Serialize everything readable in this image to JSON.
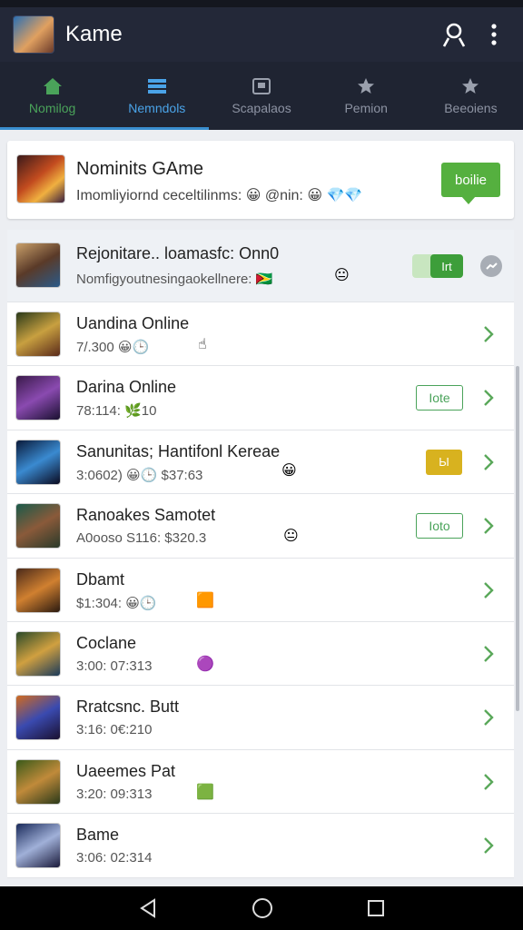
{
  "app": {
    "title": "Kame"
  },
  "tabs": [
    {
      "label": "Nomilog",
      "icon": "home-icon",
      "state": "active"
    },
    {
      "label": "Nemndols",
      "icon": "list-icon",
      "state": "active"
    },
    {
      "label": "Scapalaos",
      "icon": "box-icon",
      "state": "inactive"
    },
    {
      "label": "Pemion",
      "icon": "star-icon",
      "state": "inactive"
    },
    {
      "label": "Beeoiens",
      "icon": "star-icon",
      "state": "inactive"
    }
  ],
  "feature": {
    "title": "Nominits GAme",
    "subtitle": "Imomliyiornd ceceltilinms: 😀 @nin: 😀 💎💎",
    "button_label": "boilie"
  },
  "rows": [
    {
      "title": "Rejonitare.. loamasfc: Onn0",
      "subtitle": "Nomfigyoutnesingaokellnere: 🇬🇾",
      "emoji": "😐",
      "control": "toggle",
      "toggle_label": "Irt",
      "toggle_on": true
    },
    {
      "title": "Uandina Online",
      "subtitle": "7/.300 😀🕒",
      "emoji": "☝",
      "control": "chevron"
    },
    {
      "title": "Darina Online",
      "subtitle": "78:114: 🌿10",
      "badge": "Iote",
      "badge_style": "outline"
    },
    {
      "title": "Sanunitas; Hantifonl Kereae",
      "subtitle": "3:0602) 😀🕒    $37:63",
      "emoji": "😀",
      "badge": "Ы",
      "badge_style": "gold"
    },
    {
      "title": "Ranoakes Samotet",
      "subtitle": "A0ooso S116: $320.3",
      "emoji": "😐",
      "badge": "Ioto",
      "badge_style": "outline"
    },
    {
      "title": "Dbamt",
      "subtitle": "$1:304: 😀🕒",
      "emoji": "🟧"
    },
    {
      "title": "Coclane",
      "subtitle": "3:00: 07:313",
      "emoji": "🟣"
    },
    {
      "title": "Rratcsnc. Butt",
      "subtitle": "3:16: 0€:210"
    },
    {
      "title": "Uaeemes Pat",
      "subtitle": "3:20: 09:313",
      "emoji": "🟩"
    },
    {
      "title": "Bame",
      "subtitle": "3:06: 02:314"
    }
  ],
  "colors": {
    "appbar": "#232838",
    "tabbar": "#1f2432",
    "active_green": "#4aa35a",
    "active_blue": "#4aa3e8",
    "button_green": "#55b03f",
    "gold": "#d8b21f"
  }
}
